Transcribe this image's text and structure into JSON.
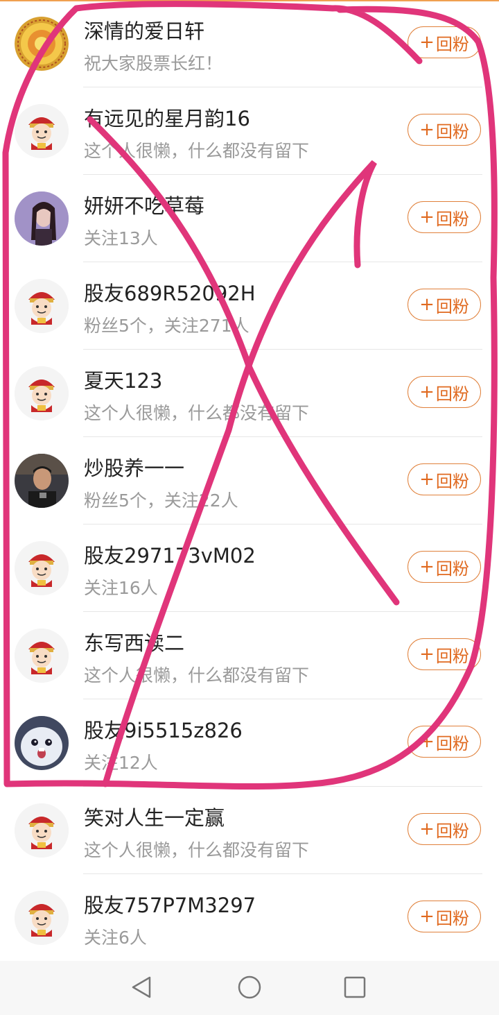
{
  "follow_button": {
    "plus": "+",
    "label": "回粉"
  },
  "users": [
    {
      "name": "深情的爱日轩",
      "desc": "祝大家股票长红！",
      "avatar": "sun-avatar"
    },
    {
      "name": "有远见的星月韵16",
      "desc": "这个人很懒，什么都没有留下",
      "avatar": "mascot-avatar"
    },
    {
      "name": "妍妍不吃草莓",
      "desc": "关注13人",
      "avatar": "girl-photo-avatar"
    },
    {
      "name": "股友689R52092H",
      "desc": "粉丝5个，关注271人",
      "avatar": "mascot-avatar"
    },
    {
      "name": "夏天123",
      "desc": "这个人很懒，什么都没有留下",
      "avatar": "mascot-avatar"
    },
    {
      "name": "炒股养一一",
      "desc": "粉丝5个，关注22人",
      "avatar": "man-photo-avatar"
    },
    {
      "name": "股友297173vM02",
      "desc": "关注16人",
      "avatar": "mascot-avatar"
    },
    {
      "name": "东写西读二",
      "desc": "这个人很懒，什么都没有留下",
      "avatar": "mascot-avatar"
    },
    {
      "name": "股友9i5515z826",
      "desc": "关注12人",
      "avatar": "bunny-avatar"
    },
    {
      "name": "笑对人生一定赢",
      "desc": "这个人很懒，什么都没有留下",
      "avatar": "mascot-avatar"
    },
    {
      "name": "股友757P7M3297",
      "desc": "关注6人",
      "avatar": "mascot-avatar"
    }
  ],
  "colors": {
    "accent": "#e06a20",
    "annotation": "#e0357a"
  },
  "navbar": {
    "buttons": [
      "back-icon",
      "home-icon",
      "recents-icon"
    ]
  }
}
